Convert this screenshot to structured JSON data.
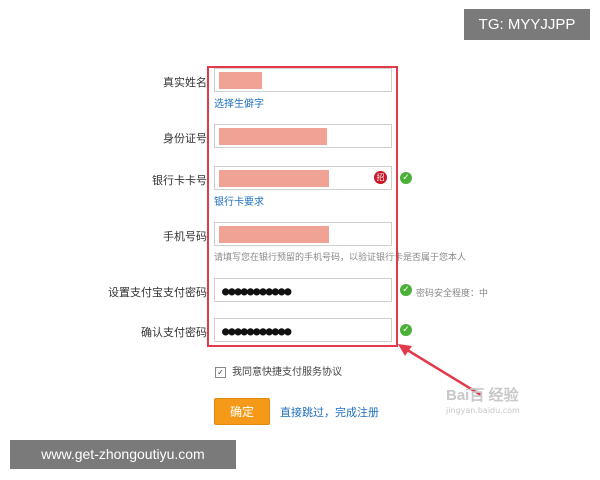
{
  "watermarks": {
    "tg": "TG: MYYJJPP",
    "url": "www.get-zhongoutiyu.com",
    "baidu": "Bai百 经验",
    "baidu_sub": "jingyan.baidu.com"
  },
  "form": {
    "real_name": {
      "label": "真实姓名",
      "link": "选择生僻字"
    },
    "id_number": {
      "label": "身份证号"
    },
    "bank_card": {
      "label": "银行卡卡号",
      "link": "银行卡要求",
      "bank_logo": "bank-logo-icon"
    },
    "phone": {
      "label": "手机号码",
      "hint": "请填写您在银行预留的手机号码，以验证银行卡是否属于您本人"
    },
    "pay_password": {
      "label": "设置支付宝支付密码",
      "value": "●●●●●●●●●●●",
      "hint": "密码安全程度：中"
    },
    "confirm_password": {
      "label": "确认支付密码",
      "value": "●●●●●●●●●●●"
    }
  },
  "agreement": {
    "label": "我同意快捷支付服务协议",
    "checked": true,
    "check_mark": "✓"
  },
  "buttons": {
    "confirm": "确定",
    "skip": "直接跳过，完成注册"
  },
  "icons": {
    "check": "✓",
    "bank_logo_glyph": "招"
  },
  "colors": {
    "highlight_box": "#e23a4a",
    "mask": "#f0a394",
    "confirm_button": "#f49a18",
    "link": "#1f6fbf",
    "valid_check": "#4caf3a"
  }
}
